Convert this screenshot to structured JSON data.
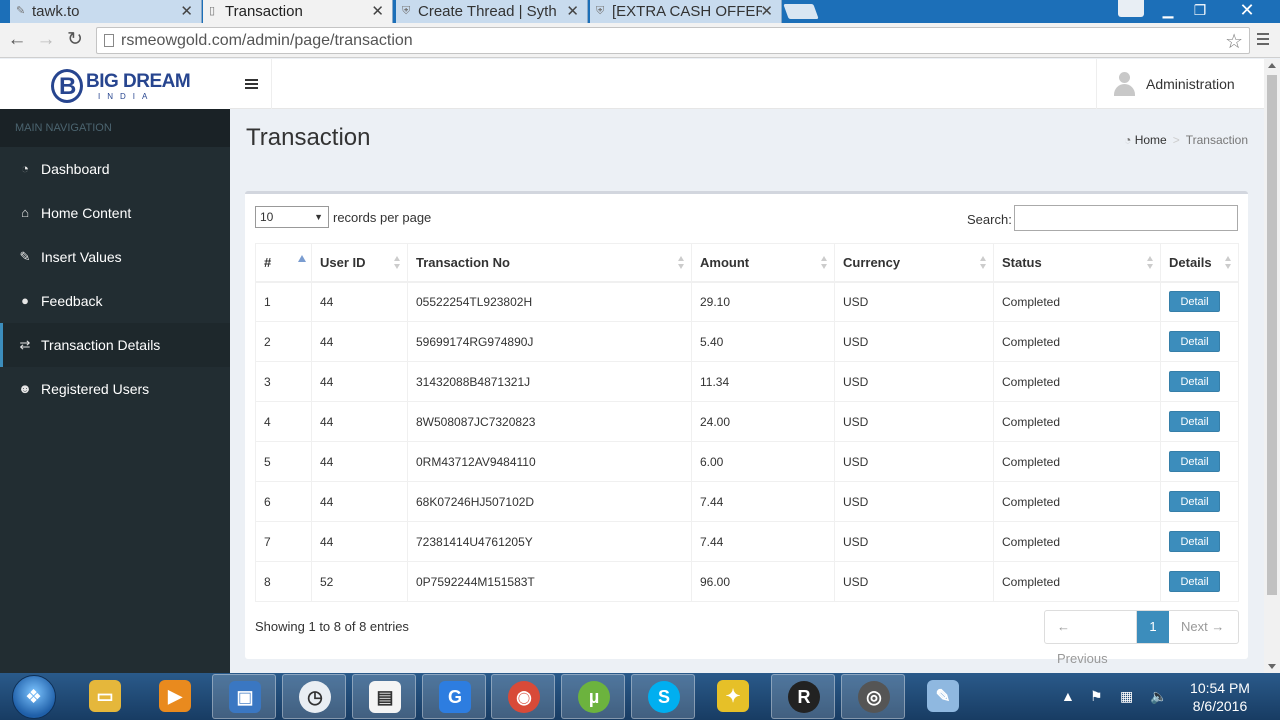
{
  "browser": {
    "tabs": [
      {
        "title": "tawk.to",
        "active": false
      },
      {
        "title": "Transaction",
        "active": true
      },
      {
        "title": "Create Thread | Syth",
        "active": false
      },
      {
        "title": "[EXTRA CASH OFFER",
        "active": false
      }
    ],
    "url": "rsmeowgold.com/admin/page/transaction"
  },
  "brand": {
    "logo_text": "BIG DREAM",
    "logo_sub": "INDIA",
    "colors": {
      "brand": "#27458f",
      "accent": "#3c8dbc",
      "sidebar": "#222d32"
    }
  },
  "header": {
    "user_name": "Administration"
  },
  "sidebar": {
    "header": "MAIN NAVIGATION",
    "items": [
      {
        "label": "Dashboard",
        "icon": "dashboard-icon",
        "active": false
      },
      {
        "label": "Home Content",
        "icon": "home-icon",
        "active": false
      },
      {
        "label": "Insert Values",
        "icon": "edit-icon",
        "active": false
      },
      {
        "label": "Feedback",
        "icon": "comments-icon",
        "active": false
      },
      {
        "label": "Transaction Details",
        "icon": "exchange-icon",
        "active": true
      },
      {
        "label": "Registered Users",
        "icon": "users-icon",
        "active": false
      }
    ]
  },
  "page": {
    "title": "Transaction",
    "breadcrumb": {
      "home": "Home",
      "current": "Transaction"
    }
  },
  "table_controls": {
    "length_value": "10",
    "length_label": "records per page",
    "search_label": "Search:",
    "search_value": ""
  },
  "table": {
    "columns": [
      "#",
      "User ID",
      "Transaction No",
      "Amount",
      "Currency",
      "Status",
      "Details"
    ],
    "sorted_column": "#",
    "button_label": "Detail",
    "rows": [
      {
        "num": "1",
        "user_id": "44",
        "txn": "05522254TL923802H",
        "amount": "29.10",
        "currency": "USD",
        "status": "Completed"
      },
      {
        "num": "2",
        "user_id": "44",
        "txn": "59699174RG974890J",
        "amount": "5.40",
        "currency": "USD",
        "status": "Completed"
      },
      {
        "num": "3",
        "user_id": "44",
        "txn": "31432088B4871321J",
        "amount": "11.34",
        "currency": "USD",
        "status": "Completed"
      },
      {
        "num": "4",
        "user_id": "44",
        "txn": "8W508087JC7320823",
        "amount": "24.00",
        "currency": "USD",
        "status": "Completed"
      },
      {
        "num": "5",
        "user_id": "44",
        "txn": "0RM43712AV9484110",
        "amount": "6.00",
        "currency": "USD",
        "status": "Completed"
      },
      {
        "num": "6",
        "user_id": "44",
        "txn": "68K07246HJ507102D",
        "amount": "7.44",
        "currency": "USD",
        "status": "Completed"
      },
      {
        "num": "7",
        "user_id": "44",
        "txn": "72381414U4761205Y",
        "amount": "7.44",
        "currency": "USD",
        "status": "Completed"
      },
      {
        "num": "8",
        "user_id": "52",
        "txn": "0P7592244M151583T",
        "amount": "96.00",
        "currency": "USD",
        "status": "Completed"
      }
    ],
    "info": "Showing 1 to 8 of 8 entries"
  },
  "pagination": {
    "prev_label": "← Previous",
    "current_page": "1",
    "next_label": "Next →"
  },
  "taskbar": {
    "time": "10:54 PM",
    "date": "8/6/2016"
  }
}
